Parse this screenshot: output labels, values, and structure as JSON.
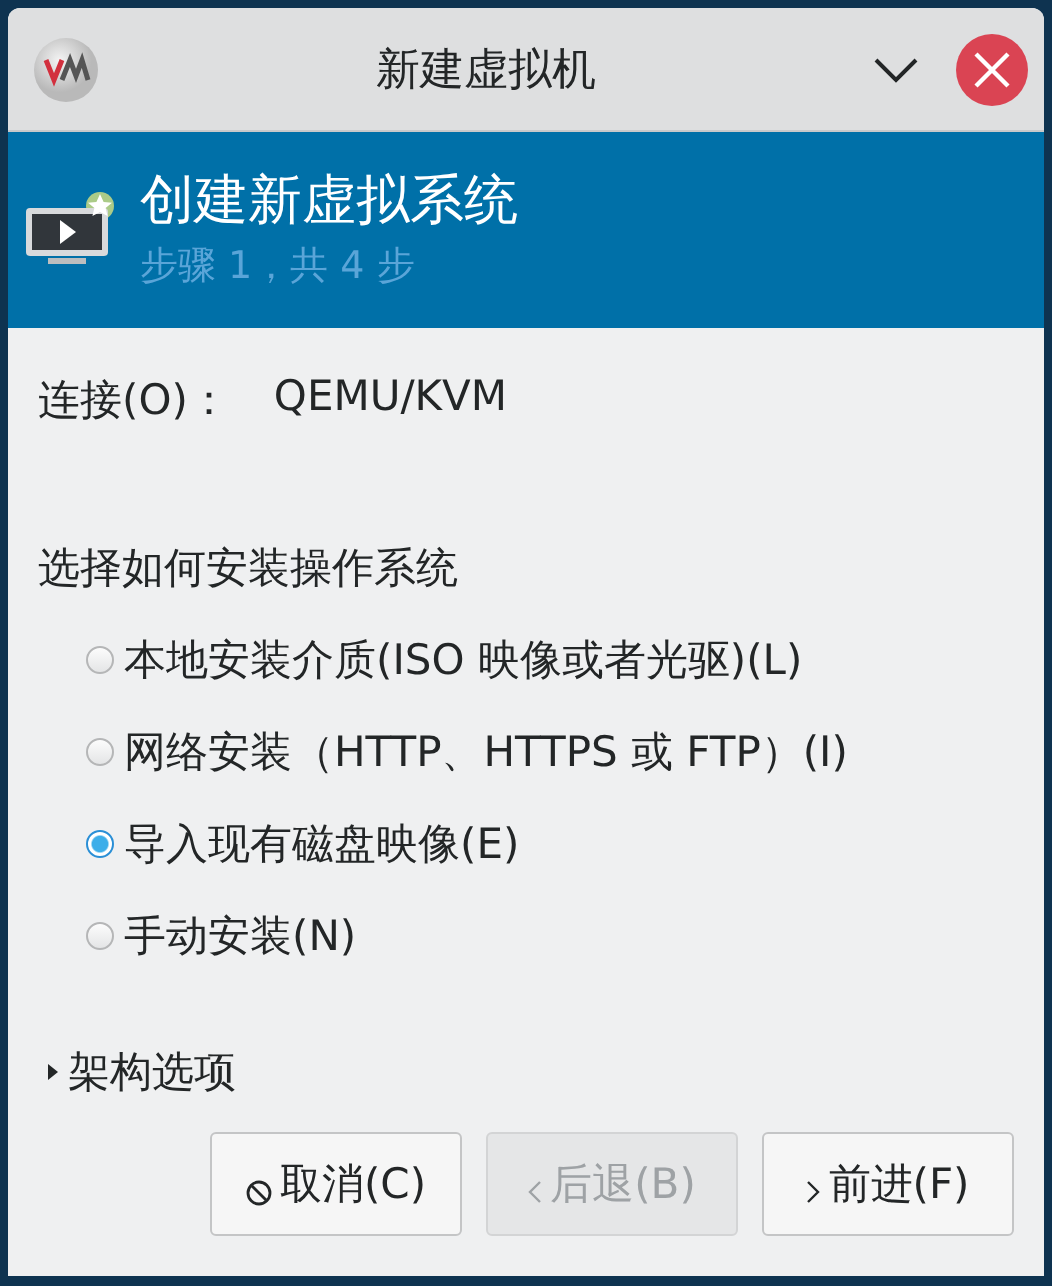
{
  "window": {
    "title": "新建虚拟机"
  },
  "header": {
    "title": "创建新虚拟系统",
    "step": "步骤 1，共 4 步"
  },
  "connection": {
    "label": "连接(O)：",
    "value": "QEMU/KVM"
  },
  "install": {
    "label": "选择如何安装操作系统",
    "options": [
      {
        "label": "本地安装介质(ISO 映像或者光驱)(L)",
        "selected": false
      },
      {
        "label": "网络安装（HTTP、HTTPS 或 FTP）(I)",
        "selected": false
      },
      {
        "label": "导入现有磁盘映像(E)",
        "selected": true
      },
      {
        "label": "手动安装(N)",
        "selected": false
      }
    ]
  },
  "expander": {
    "label": "架构选项",
    "expanded": false
  },
  "buttons": [
    {
      "label": "取消(C)",
      "kind": "cancel",
      "disabled": false
    },
    {
      "label": "后退(B)",
      "kind": "back",
      "disabled": true
    },
    {
      "label": "前进(F)",
      "kind": "forward",
      "disabled": false
    }
  ]
}
